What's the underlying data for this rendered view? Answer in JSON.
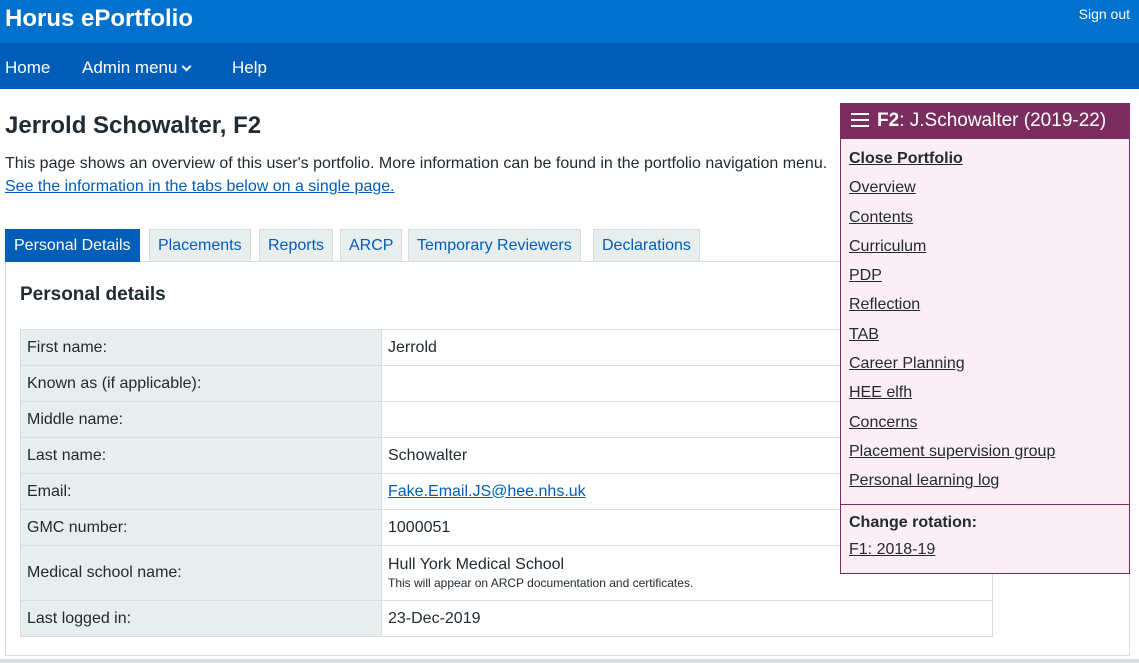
{
  "header": {
    "brand": "Horus ePortfolio",
    "signout": "Sign out"
  },
  "nav": {
    "home": "Home",
    "admin_menu": "Admin menu",
    "help": "Help"
  },
  "page": {
    "title": "Jerrold Schowalter, F2",
    "intro": "This page shows an overview of this user's portfolio. More information can be found in the portfolio navigation menu.",
    "single_page_link": "See the information in the tabs below on a single page."
  },
  "tabs": [
    {
      "label": "Personal Details",
      "active": true
    },
    {
      "label": "Placements",
      "active": false
    },
    {
      "label": "Reports",
      "active": false
    },
    {
      "label": "ARCP",
      "active": false
    },
    {
      "label": "Temporary Reviewers",
      "active": false
    },
    {
      "label": "Declarations",
      "active": false
    }
  ],
  "personal": {
    "title": "Personal details",
    "rows": [
      {
        "label": "First name:",
        "value": "Jerrold"
      },
      {
        "label": "Known as (if applicable):",
        "value": ""
      },
      {
        "label": "Middle name:",
        "value": ""
      },
      {
        "label": "Last name:",
        "value": "Schowalter"
      },
      {
        "label": "Email:",
        "value": "Fake.Email.JS@hee.nhs.uk"
      },
      {
        "label": "GMC number:",
        "value": "1000051"
      },
      {
        "label": "Medical school name:",
        "value": "Hull York Medical School",
        "hint": "This will appear on ARCP documentation and certificates."
      },
      {
        "label": "Last logged in:",
        "value": "23-Dec-2019"
      }
    ]
  },
  "portfolio_menu": {
    "title_bold": "F2",
    "title_rest": ": J.Schowalter (2019-22)",
    "links": [
      "Close Portfolio",
      "Overview",
      "Contents",
      "Curriculum",
      "PDP",
      "Reflection",
      "TAB",
      "Career Planning",
      "HEE elfh",
      "Concerns",
      "Placement supervision group",
      "Personal learning log"
    ],
    "change_rotation_title": "Change rotation:",
    "rotation_link": "F1: 2018-19"
  },
  "colors": {
    "header": "#0072ce",
    "nav": "#005eb8",
    "menu_accent": "#7a2d5e",
    "menu_bg": "#fbeef4"
  }
}
